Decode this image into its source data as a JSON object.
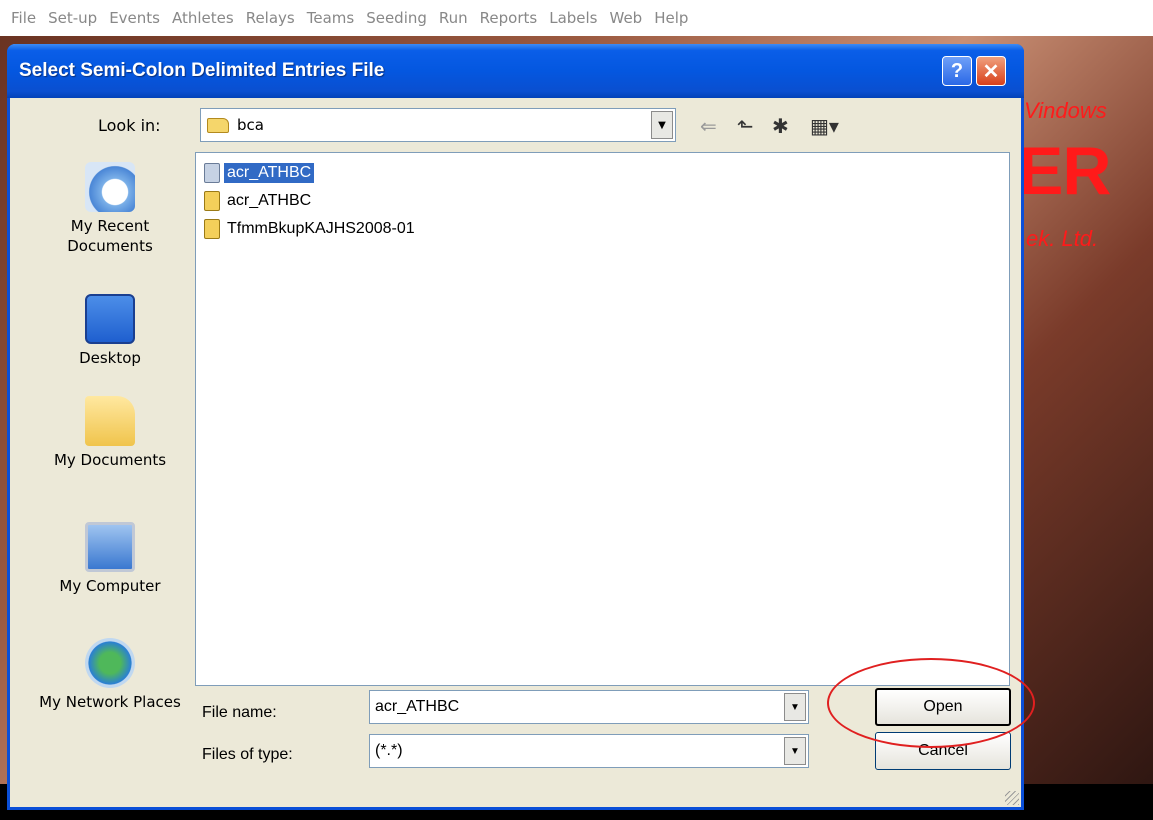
{
  "menubar": {
    "items": [
      "File",
      "Set-up",
      "Events",
      "Athletes",
      "Relays",
      "Teams",
      "Seeding",
      "Run",
      "Reports",
      "Labels",
      "Web",
      "Help"
    ]
  },
  "background": {
    "brand_line1": "Vindows",
    "brand_line2": "ER",
    "brand_line3": "ek. Ltd."
  },
  "dialog": {
    "title": "Select Semi-Colon Delimited Entries File",
    "help_label": "?",
    "close_label": "✕",
    "lookin_label": "Look in:",
    "lookin_value": "bca",
    "places": [
      {
        "label": "My Recent Documents"
      },
      {
        "label": "Desktop"
      },
      {
        "label": "My Documents"
      },
      {
        "label": "My Computer"
      },
      {
        "label": "My Network Places"
      }
    ],
    "files": [
      {
        "name": "acr_ATHBC",
        "icon": "text-document-icon"
      },
      {
        "name": "acr_ATHBC",
        "icon": "zip-folder-icon"
      },
      {
        "name": "TfmmBkupKAJHS2008-01",
        "icon": "zip-folder-icon"
      }
    ],
    "filename_label": "File name:",
    "filename_value": "acr_ATHBC",
    "filetype_label": "Files of type:",
    "filetype_value": "(*.*)",
    "open_label": "Open",
    "cancel_label": "Cancel"
  },
  "colors": {
    "title_blue": "#0457e0",
    "selection": "#316ac5",
    "annotation_red": "#e02020",
    "brand_red": "#ff1a1a"
  }
}
